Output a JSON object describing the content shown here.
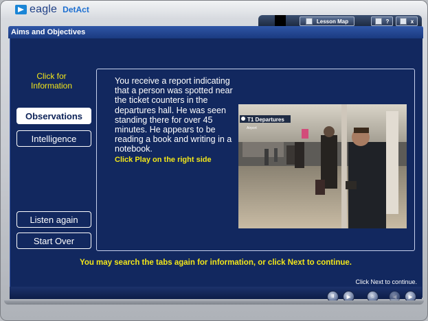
{
  "brand": {
    "name": "eagle",
    "product": "DetAct"
  },
  "titlebar": {
    "lesson_map": "Lesson Map",
    "help": "?",
    "close": "x"
  },
  "section_title": "Aims and Objectives",
  "sidebar": {
    "click_info_line1": "Click for",
    "click_info_line2": "Information",
    "observations": "Observations",
    "intelligence": "Intelligence",
    "listen_again": "Listen again",
    "start_over": "Start Over"
  },
  "report": {
    "text": "You receive a report indicating that a person was spotted near the ticket counters in the departures hall. He was seen standing there for over 45 minutes. He appears to be reading a book and writing in a notebook.",
    "hint": "Click Play on the right side"
  },
  "video": {
    "sign_text": "T1 Departures",
    "sign_sub": "Airport"
  },
  "footer": {
    "message": "You may search the tabs again for information, or click Next to continue.",
    "next_hint": "Click Next to continue."
  },
  "controls": [
    "pause-icon",
    "play-icon",
    "home-icon",
    "back-icon",
    "next-icon"
  ],
  "colors": {
    "panel": "#12285f",
    "accent_yellow": "#f2e61a",
    "title_blue": "#2f56a6"
  }
}
